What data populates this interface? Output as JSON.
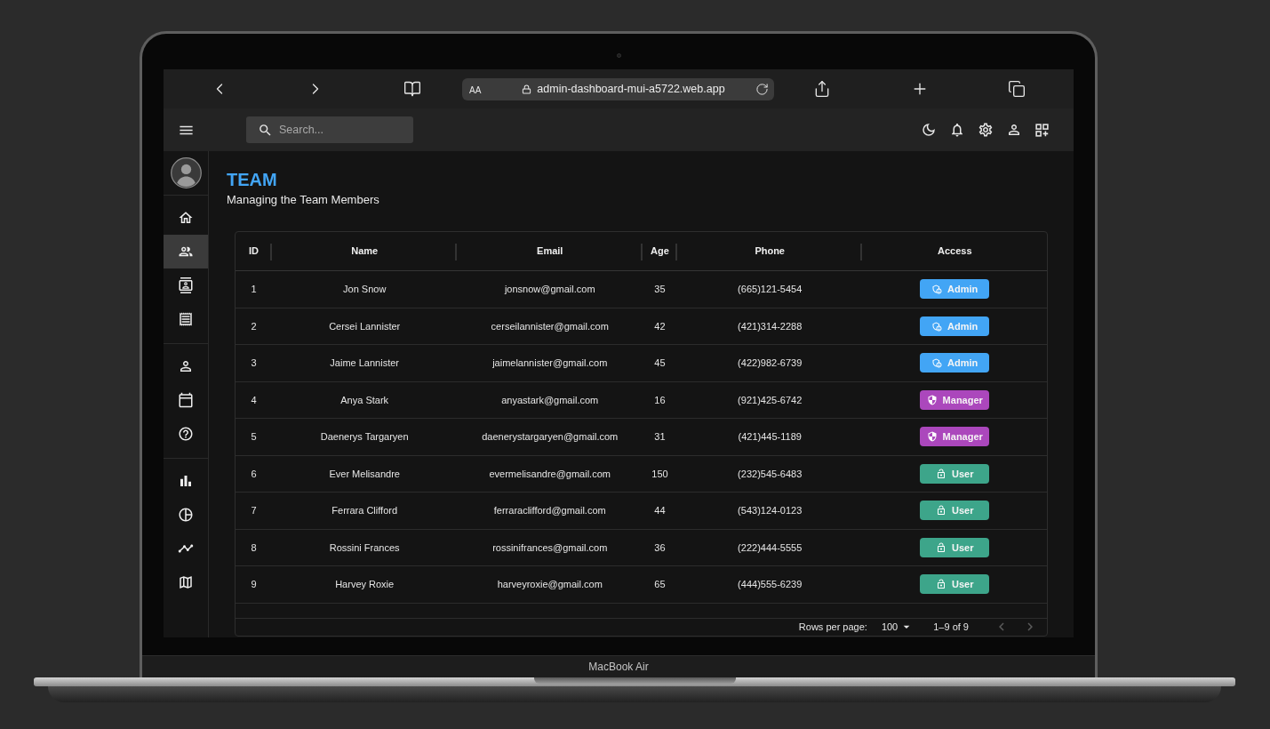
{
  "device": {
    "label": "MacBook Air"
  },
  "browser": {
    "text_size_button": "AA",
    "url": "admin-dashboard-mui-a5722.web.app"
  },
  "topbar": {
    "search": {
      "placeholder": "Search..."
    }
  },
  "sidebar": {
    "groups": [
      {
        "items": [
          {
            "kind": "home",
            "selected": false
          },
          {
            "kind": "team",
            "selected": true
          },
          {
            "kind": "contacts",
            "selected": false
          },
          {
            "kind": "invoices",
            "selected": false
          }
        ]
      },
      {
        "items": [
          {
            "kind": "profile",
            "selected": false
          },
          {
            "kind": "calendar",
            "selected": false
          },
          {
            "kind": "faq",
            "selected": false
          }
        ]
      },
      {
        "items": [
          {
            "kind": "bar",
            "selected": false
          },
          {
            "kind": "pie",
            "selected": false
          },
          {
            "kind": "line",
            "selected": false
          },
          {
            "kind": "geography",
            "selected": false
          }
        ]
      }
    ]
  },
  "page": {
    "title": "TEAM",
    "subtitle": "Managing the Team Members"
  },
  "table": {
    "columns": [
      "ID",
      "Name",
      "Email",
      "Age",
      "Phone",
      "Access"
    ],
    "rows": [
      {
        "id": "1",
        "name": "Jon Snow",
        "email": "jonsnow@gmail.com",
        "age": "35",
        "phone": "(665)121-5454",
        "access": {
          "kind": "admin",
          "label": "Admin",
          "color": "#42a5f5"
        }
      },
      {
        "id": "2",
        "name": "Cersei Lannister",
        "email": "cerseilannister@gmail.com",
        "age": "42",
        "phone": "(421)314-2288",
        "access": {
          "kind": "admin",
          "label": "Admin",
          "color": "#42a5f5"
        }
      },
      {
        "id": "3",
        "name": "Jaime Lannister",
        "email": "jaimelannister@gmail.com",
        "age": "45",
        "phone": "(422)982-6739",
        "access": {
          "kind": "admin",
          "label": "Admin",
          "color": "#42a5f5"
        }
      },
      {
        "id": "4",
        "name": "Anya Stark",
        "email": "anyastark@gmail.com",
        "age": "16",
        "phone": "(921)425-6742",
        "access": {
          "kind": "manager",
          "label": "Manager",
          "color": "#ab47bc"
        }
      },
      {
        "id": "5",
        "name": "Daenerys Targaryen",
        "email": "daenerystargaryen@gmail.com",
        "age": "31",
        "phone": "(421)445-1189",
        "access": {
          "kind": "manager",
          "label": "Manager",
          "color": "#ab47bc"
        }
      },
      {
        "id": "6",
        "name": "Ever Melisandre",
        "email": "evermelisandre@gmail.com",
        "age": "150",
        "phone": "(232)545-6483",
        "access": {
          "kind": "user",
          "label": "User",
          "color": "#3da58a"
        }
      },
      {
        "id": "7",
        "name": "Ferrara Clifford",
        "email": "ferraraclifford@gmail.com",
        "age": "44",
        "phone": "(543)124-0123",
        "access": {
          "kind": "user",
          "label": "User",
          "color": "#3da58a"
        }
      },
      {
        "id": "8",
        "name": "Rossini Frances",
        "email": "rossinifrances@gmail.com",
        "age": "36",
        "phone": "(222)444-5555",
        "access": {
          "kind": "user",
          "label": "User",
          "color": "#3da58a"
        }
      },
      {
        "id": "9",
        "name": "Harvey Roxie",
        "email": "harveyroxie@gmail.com",
        "age": "65",
        "phone": "(444)555-6239",
        "access": {
          "kind": "user",
          "label": "User",
          "color": "#3da58a"
        }
      }
    ],
    "pagination": {
      "rows_per_page_label": "Rows per page:",
      "rows_per_page": "100",
      "range": "1–9 of 9",
      "previous": {
        "disabled": true
      },
      "next": {
        "disabled": true
      }
    }
  }
}
